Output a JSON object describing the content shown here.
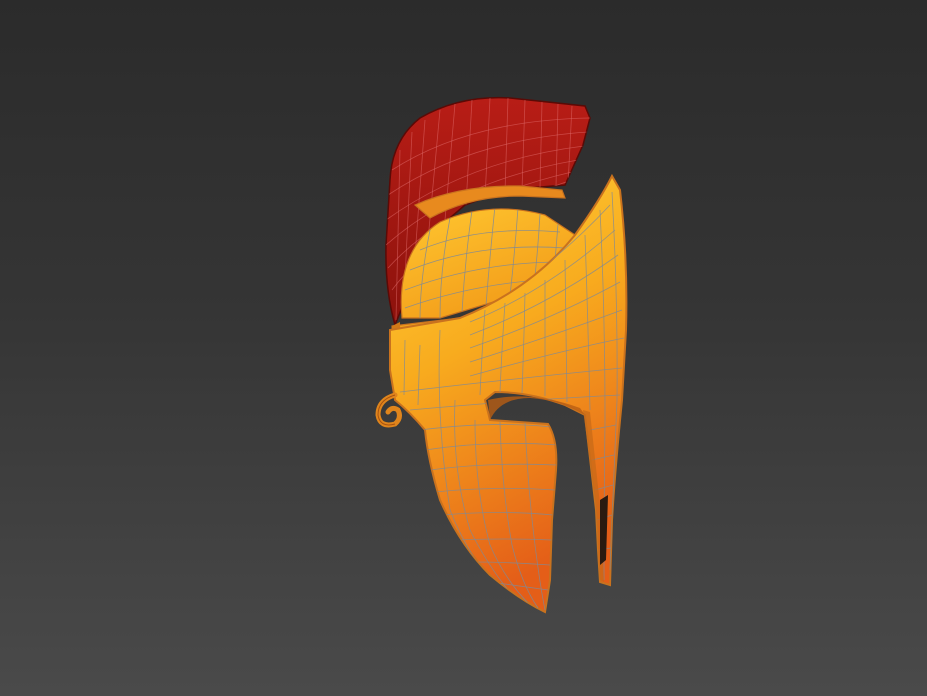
{
  "viewport": {
    "background_top": "#2b2b2b",
    "background_bottom": "#4a4a4a"
  },
  "model": {
    "subject": "corinthian-helmet",
    "colors": {
      "crest": "#a81a14",
      "crest_dark": "#6e0c08",
      "shell_light": "#ffc02a",
      "shell_mid": "#f5a21a",
      "shell_dark": "#e66a18",
      "wire": "#7f8a96",
      "edge": "#c9721e"
    }
  }
}
